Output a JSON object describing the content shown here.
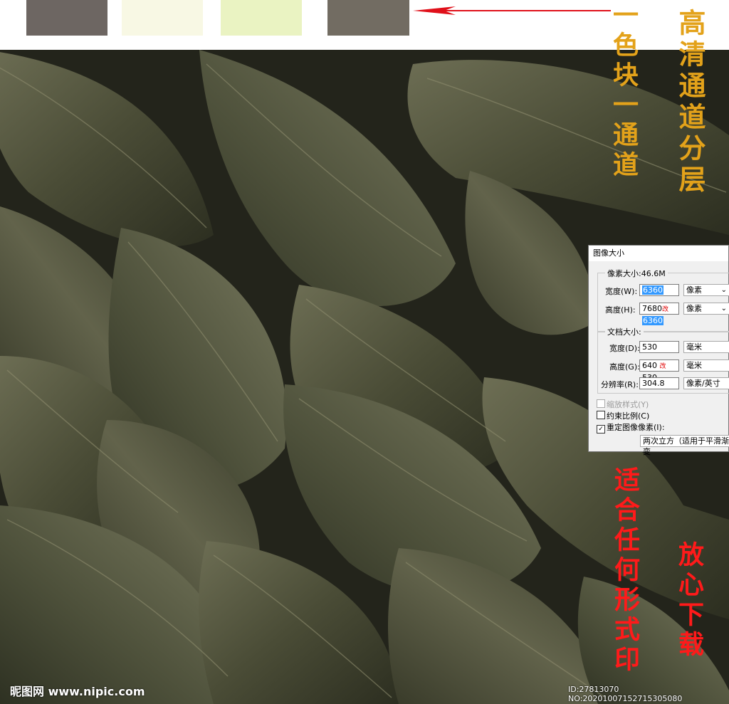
{
  "swatches": [
    {
      "name": "swatch-1",
      "color": "#6d6662"
    },
    {
      "name": "swatch-2",
      "color": "#f8f8e4"
    },
    {
      "name": "swatch-3",
      "color": "#eaf3c2"
    },
    {
      "name": "swatch-4",
      "color": "#726c62"
    }
  ],
  "arrow": {
    "color": "#e0101a"
  },
  "promo": {
    "hd_channels": "高清通道分层",
    "one_color_channel": "一色块一通道",
    "any_print": "适合任何形式印",
    "download": "放心下载",
    "gold_color": "#e3a21a",
    "red_color": "#ff1a1a"
  },
  "dialog": {
    "title": "图像大小",
    "pixel_dims_label": "像素大小:46.6M",
    "width_label": "宽度(W):",
    "width_value": "6360",
    "width_unit": "像素",
    "height_label": "高度(H):",
    "height_old": "7680",
    "height_value": "6360",
    "height_unit": "像素",
    "doc_size_label": "文档大小:",
    "doc_width_label": "宽度(D):",
    "doc_width_value": "530",
    "doc_width_unit": "毫米",
    "doc_height_label": "高度(G):",
    "doc_height_old": "640",
    "doc_height_value": "530",
    "doc_height_unit": "毫米",
    "resolution_label": "分辨率(R):",
    "resolution_value": "304.8",
    "resolution_unit": "像素/英寸",
    "scale_styles": "缩放样式(Y)",
    "constrain": "约束比例(C)",
    "resample": "重定图像像素(I):",
    "resample_method": "两次立方（适用于平滑渐变",
    "red_mark": "改"
  },
  "watermark": "昵图网 www.nipic.com",
  "id_tag": "ID:27813070 NO:20201007152715305080"
}
